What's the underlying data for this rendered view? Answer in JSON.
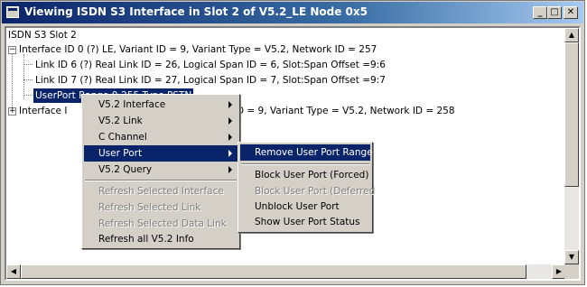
{
  "window": {
    "title": "Viewing ISDN S3 Interface in Slot  2 of V5.2_LE Node 0x5",
    "minimize": "_",
    "maximize": "□",
    "close": "✕"
  },
  "tree": {
    "root": "ISDN S3 Slot 2",
    "iface0": "Interface ID 0 (?)  LE,  Variant ID = 9, Variant Type = V5.2,  Network ID = 257",
    "link6": "Link ID 6 (?)  Real Link ID = 26, Logical Span ID = 6,  Slot:Span Offset =9:6",
    "link7": "Link ID 7 (?)  Real Link ID = 27, Logical Span ID = 7,  Slot:Span Offset =9:7",
    "userport": "UserPort Range   0-255  Type   PSTN",
    "iface1_left": "Interface I",
    "iface1_right": "D = 9, Variant Type = V5.2,  Network ID = 258",
    "expand_minus": "−",
    "expand_plus": "+"
  },
  "context_menu": {
    "items": [
      {
        "label": "V5.2 Interface",
        "submenu": true,
        "enabled": true
      },
      {
        "label": "V5.2 Link",
        "submenu": true,
        "enabled": true
      },
      {
        "label": "C Channel",
        "submenu": true,
        "enabled": true
      },
      {
        "label": "User Port",
        "submenu": true,
        "enabled": true,
        "highlighted": true
      },
      {
        "label": "V5.2 Query",
        "submenu": true,
        "enabled": true
      },
      {
        "label": "Refresh Selected Interface",
        "enabled": false
      },
      {
        "label": "Refresh Selected Link",
        "enabled": false
      },
      {
        "label": "Refresh Selected Data Link",
        "enabled": false
      },
      {
        "label": "Refresh all V5.2 Info",
        "enabled": true
      }
    ]
  },
  "submenu": {
    "items": [
      {
        "label": "Remove User Port Range",
        "enabled": true,
        "highlighted": true
      },
      {
        "label": "Block User Port (Forced)",
        "enabled": true
      },
      {
        "label": "Block  User Port (Deferred",
        "enabled": false
      },
      {
        "label": "Unblock  User Port",
        "enabled": true
      },
      {
        "label": "Show User Port Status",
        "enabled": true
      }
    ]
  },
  "scrollbars": {
    "up": "▲",
    "down": "▼",
    "left": "◀",
    "right": "▶"
  },
  "colors": {
    "selection": "#0a246a",
    "title_start": "#0a246a",
    "title_end": "#a6caf0"
  }
}
